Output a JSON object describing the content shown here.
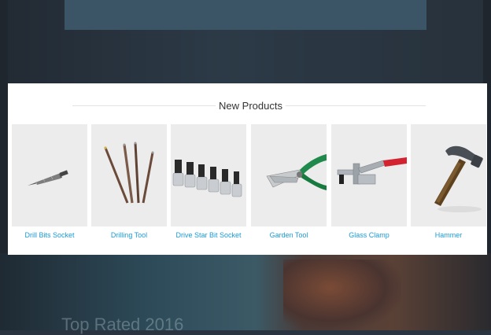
{
  "modal": {
    "title": "New Products",
    "products": [
      {
        "name": "Drill Bits Socket",
        "icon": "drill-bit-icon"
      },
      {
        "name": "Drilling Tool",
        "icon": "drilling-tool-icon"
      },
      {
        "name": "Drive Star Bit Socket",
        "icon": "socket-set-icon"
      },
      {
        "name": "Garden Tool",
        "icon": "pruning-shears-icon"
      },
      {
        "name": "Glass Clamp",
        "icon": "toggle-clamp-icon"
      },
      {
        "name": "Hammer",
        "icon": "hammer-icon"
      }
    ]
  },
  "background": {
    "promo_text": "Top Rated 2016"
  },
  "colors": {
    "link": "#1a9bd7",
    "thumb_bg": "#ececec",
    "accent_green": "#1f8a4c",
    "accent_red": "#d42330"
  }
}
